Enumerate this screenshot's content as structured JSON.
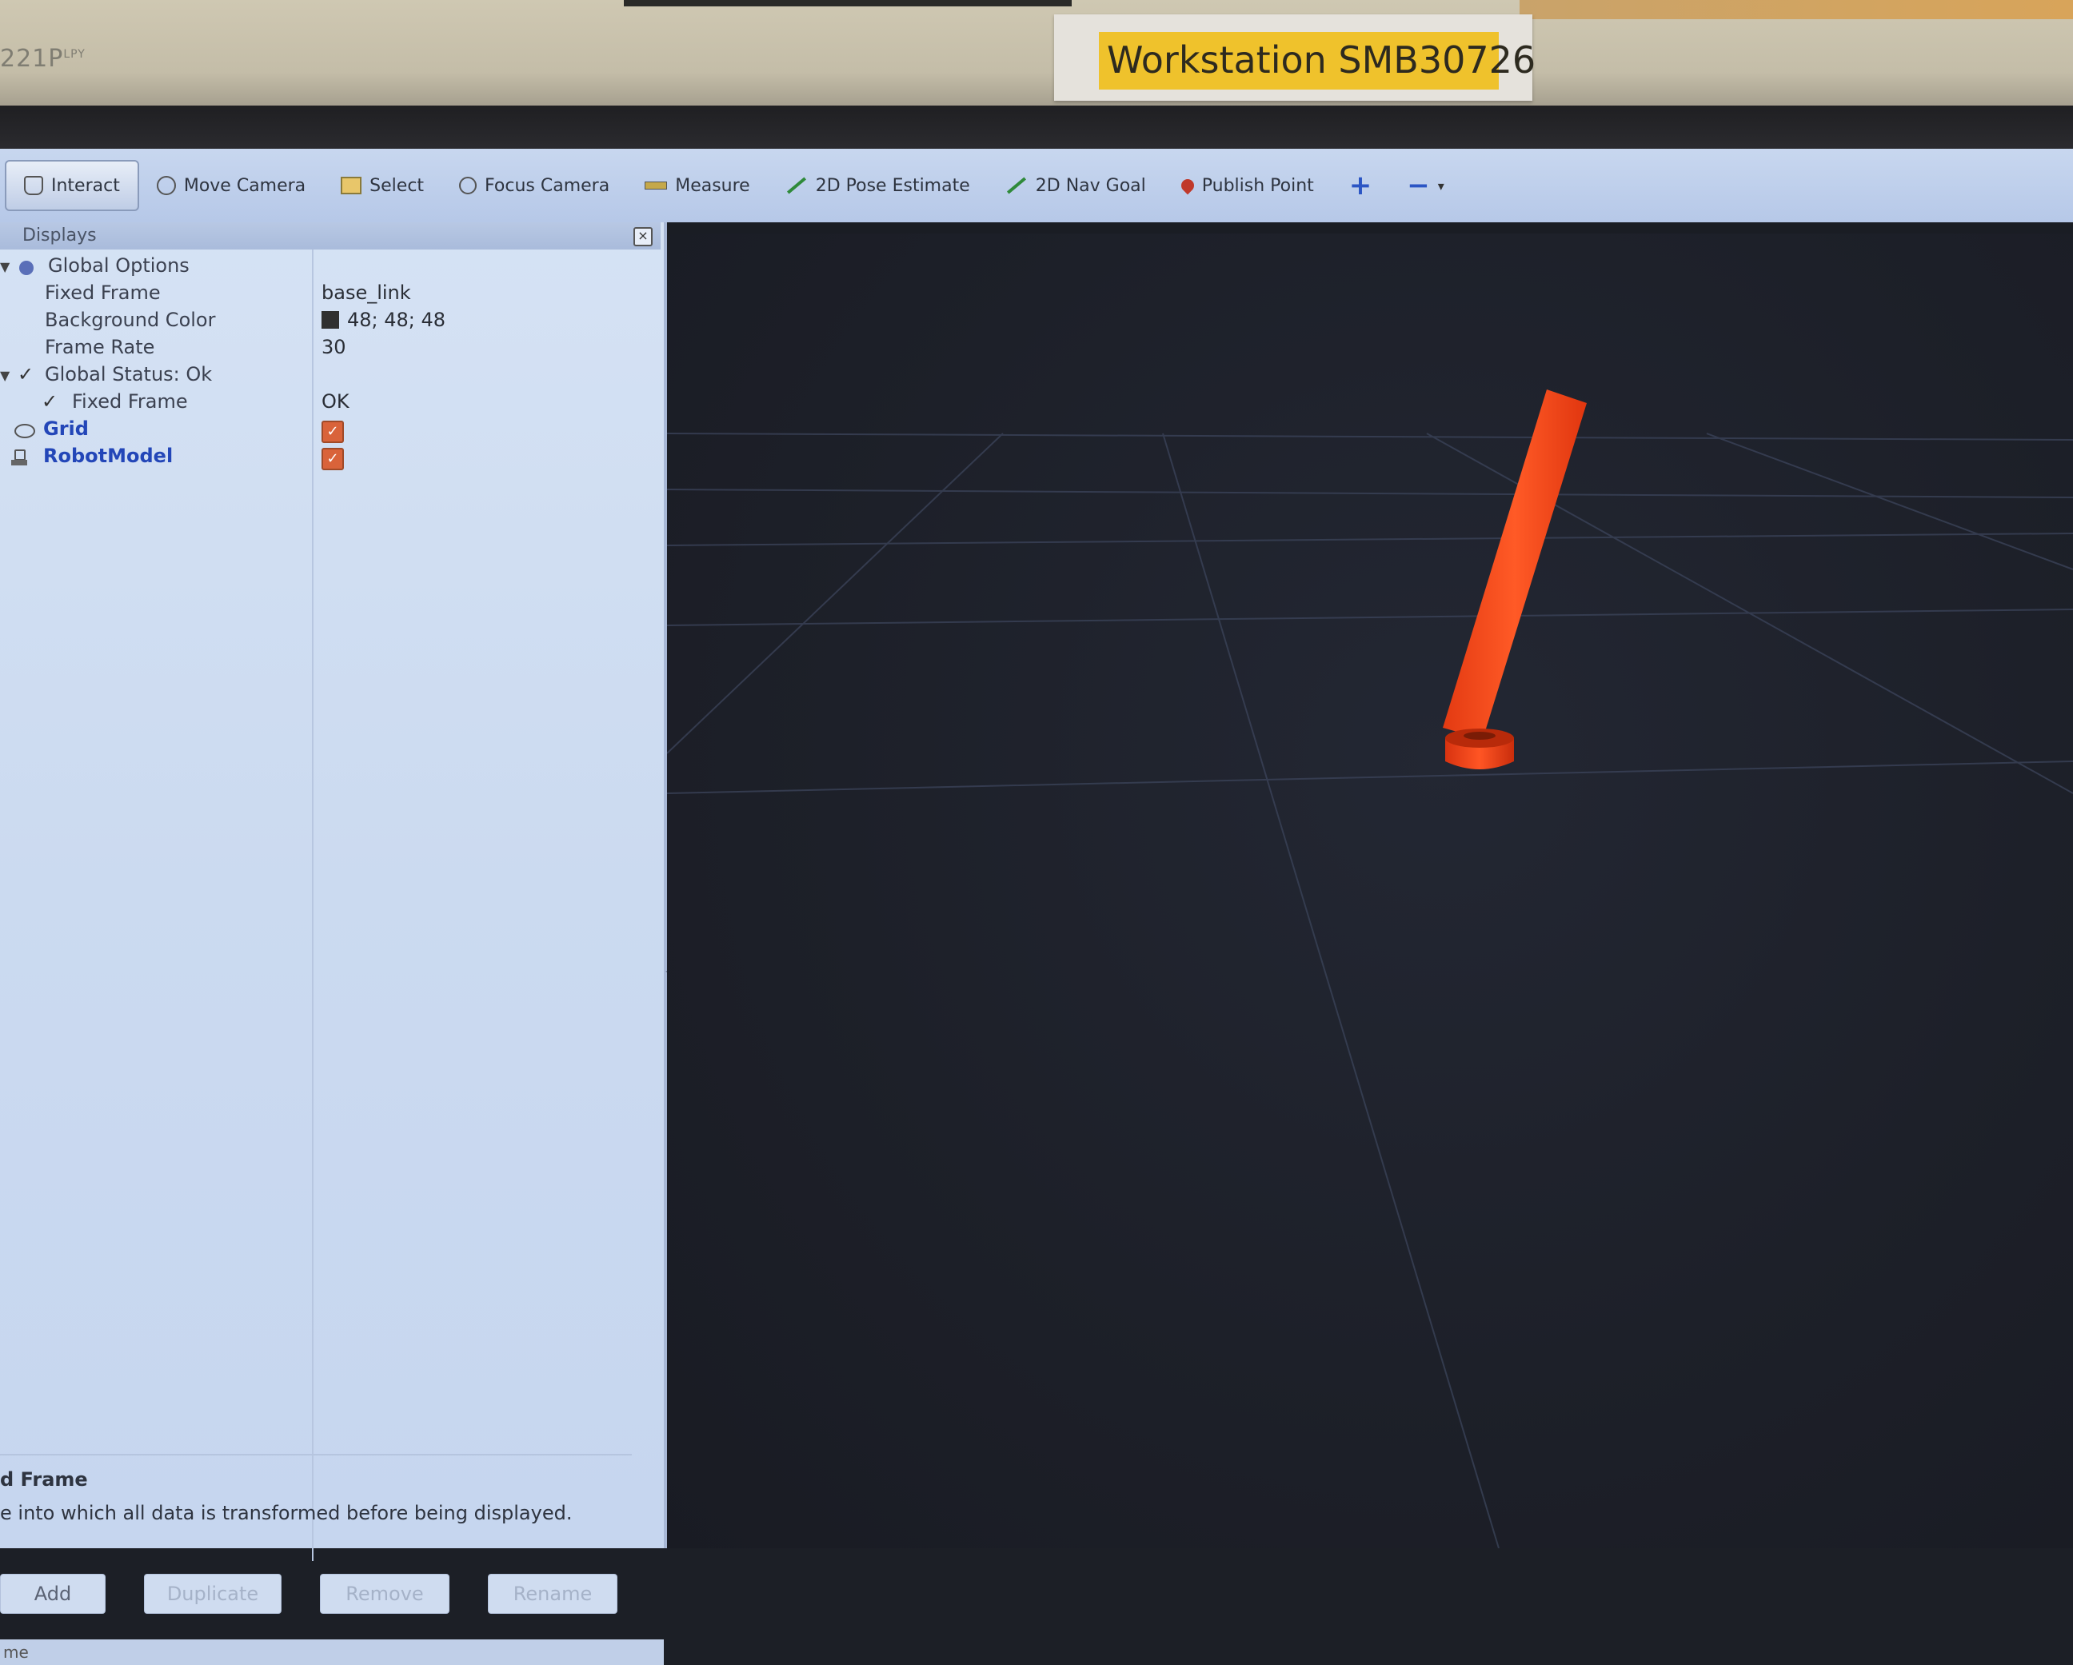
{
  "monitor": {
    "model": "221P",
    "model_sup": "LPY",
    "asset_label": "Workstation  SMB30726"
  },
  "toolbar": {
    "tools": [
      {
        "label": "Interact",
        "icon": "hand-pointer-icon",
        "active": true
      },
      {
        "label": "Move Camera",
        "icon": "move-camera-icon"
      },
      {
        "label": "Select",
        "icon": "select-icon"
      },
      {
        "label": "Focus Camera",
        "icon": "focus-camera-icon"
      },
      {
        "label": "Measure",
        "icon": "ruler-icon"
      },
      {
        "label": "2D Pose Estimate",
        "icon": "green-arrow-icon"
      },
      {
        "label": "2D Nav Goal",
        "icon": "green-arrow-icon"
      },
      {
        "label": "Publish Point",
        "icon": "map-pin-icon"
      }
    ],
    "add_tool_icon": "plus-icon",
    "remove_tool_icon": "minus-icon"
  },
  "displays": {
    "title": "Displays",
    "global_options": {
      "label": "Global Options",
      "fixed_frame": {
        "key": "Fixed Frame",
        "value": "base_link"
      },
      "background_color": {
        "key": "Background Color",
        "value": "48; 48; 48",
        "swatch": "#303030"
      },
      "frame_rate": {
        "key": "Frame Rate",
        "value": "30"
      }
    },
    "global_status": {
      "label": "Global Status: Ok",
      "fixed_frame": {
        "key": "Fixed Frame",
        "value": "OK"
      }
    },
    "grid": {
      "label": "Grid",
      "enabled": true
    },
    "robot_model": {
      "label": "RobotModel",
      "enabled": true
    }
  },
  "help": {
    "title": "d Frame",
    "text": "e into which all data is transformed before being displayed."
  },
  "buttons": {
    "add": "Add",
    "duplicate": "Duplicate",
    "remove": "Remove",
    "rename": "Rename"
  },
  "status_bar": {
    "text": "me"
  },
  "colors": {
    "robot": "#ff4a1c",
    "grid": "#3a4258",
    "accent_blue": "#2346b8"
  }
}
